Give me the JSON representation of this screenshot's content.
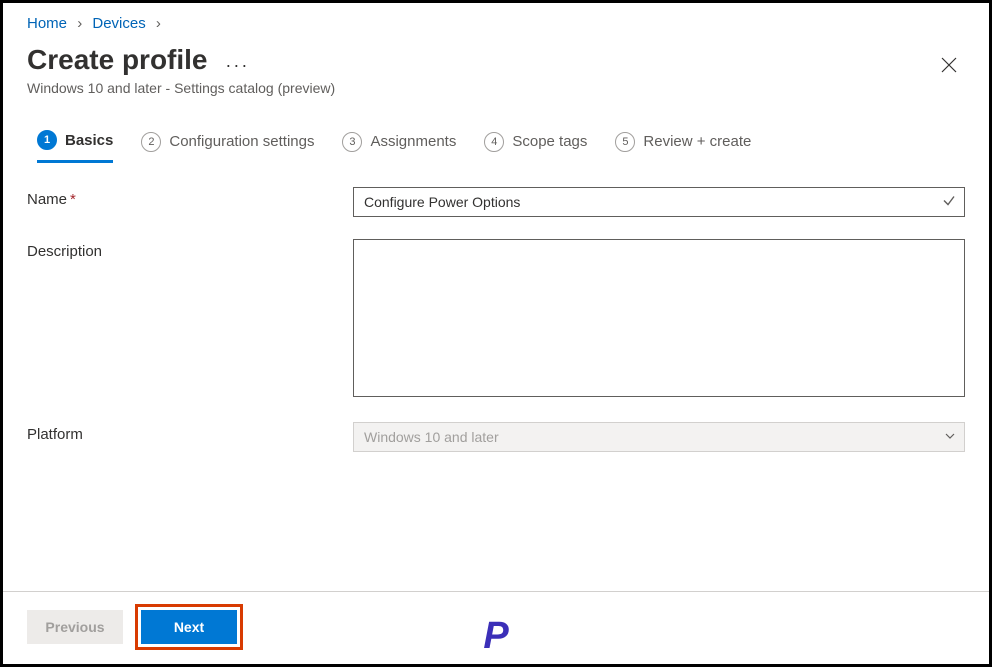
{
  "breadcrumb": {
    "items": [
      "Home",
      "Devices"
    ]
  },
  "header": {
    "title": "Create profile",
    "subtitle": "Windows 10 and later - Settings catalog (preview)"
  },
  "tabs": [
    {
      "num": "1",
      "label": "Basics"
    },
    {
      "num": "2",
      "label": "Configuration settings"
    },
    {
      "num": "3",
      "label": "Assignments"
    },
    {
      "num": "4",
      "label": "Scope tags"
    },
    {
      "num": "5",
      "label": "Review + create"
    }
  ],
  "form": {
    "name_label": "Name",
    "name_value": "Configure Power Options",
    "description_label": "Description",
    "description_value": "",
    "platform_label": "Platform",
    "platform_value": "Windows 10 and later"
  },
  "footer": {
    "previous_label": "Previous",
    "next_label": "Next"
  },
  "watermark": "P"
}
